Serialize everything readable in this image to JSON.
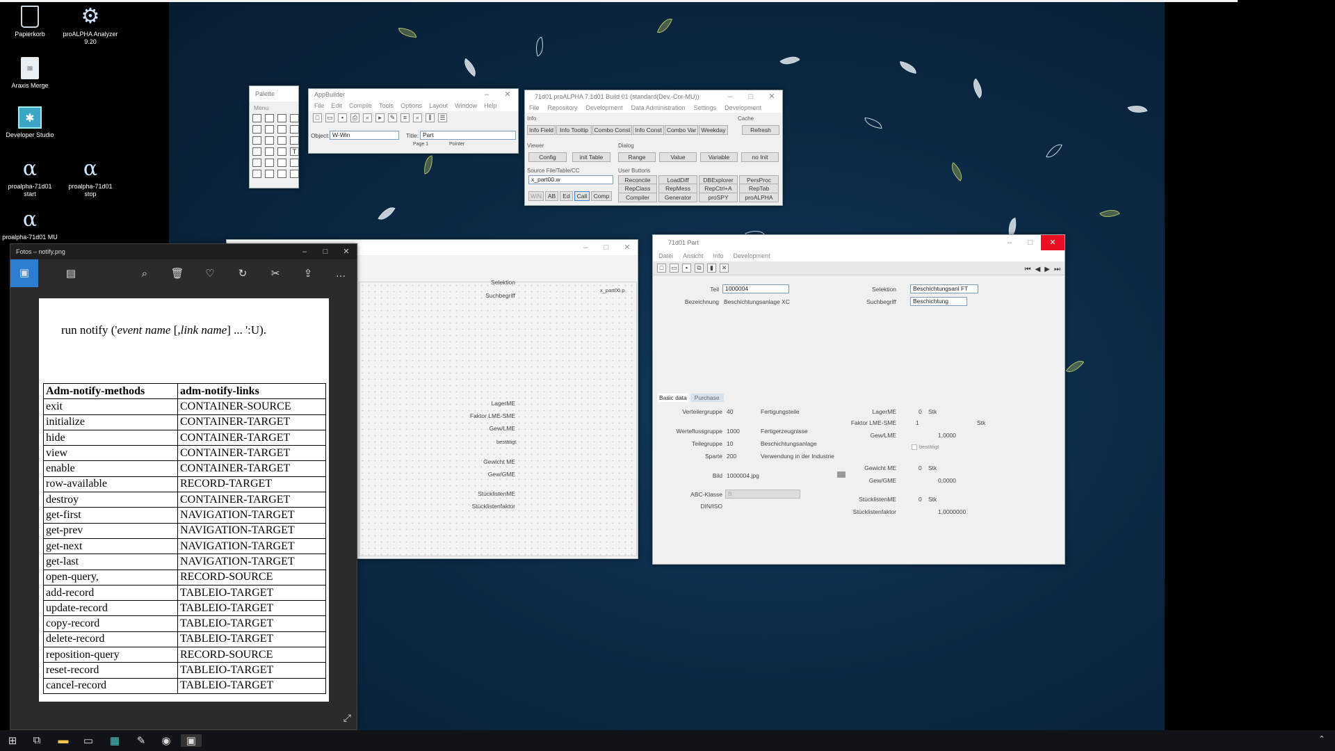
{
  "desktop": {
    "icons": [
      {
        "label": "Papierkorb",
        "sym": "🗑"
      },
      {
        "label": "proALPHA Analyzer 9.20",
        "sym": "⚙"
      },
      {
        "label": "Araxis Merge",
        "sym": "≡"
      },
      {
        "label": "Developer Studio",
        "sym": "✱"
      },
      {
        "label": "proalpha-71d01 start",
        "sym": "α"
      },
      {
        "label": "proalpha-71d01 stop",
        "sym": "α"
      },
      {
        "label": "proalpha-71d01 MU",
        "sym": "α"
      }
    ]
  },
  "palette": {
    "title": "Palette",
    "menu": "Menu"
  },
  "appbuilder": {
    "title": "AppBuilder",
    "menu": [
      "File",
      "Edit",
      "Compile",
      "Tools",
      "Options",
      "Layout",
      "Window",
      "Help"
    ],
    "object_label": "Object:",
    "object_value": "W-Win",
    "title_label": "Title:",
    "title_value": "Part",
    "page_label": "Page 1",
    "pointer_label": "Pointer"
  },
  "devtool": {
    "title": "71d01 proALPHA 7.1d01 Build 01 (standard(Dev.-Cor-MU))",
    "menu": [
      "File",
      "Repository",
      "Development",
      "Data Administration",
      "Settings",
      "Development"
    ],
    "info_label": "Info",
    "cache_label": "Cache",
    "info_buttons": [
      "Info Field",
      "Info Tooltip",
      "Combo Const",
      "Info Const",
      "Combo Var",
      "Weekday"
    ],
    "refresh": "Refresh",
    "viewer_label": "Viewer",
    "viewer_buttons": [
      "Config",
      "init Table"
    ],
    "dialog_label": "Dialog",
    "dialog_buttons": [
      "Range",
      "Value",
      "Variable",
      "no Init"
    ],
    "source_label": "Source File/Table/CC",
    "source_value": "x_part00.w",
    "source_buttons": [
      "WiN",
      "AB",
      "Ed",
      "Call",
      "Comp"
    ],
    "user_label": "User Buttons",
    "user_buttons": [
      [
        "Reconcile",
        "LoadDiff",
        "DBExplorer",
        "PersProc"
      ],
      [
        "RepClass",
        "RepMess",
        "RepCtrl+A",
        "RepTab"
      ],
      [
        "Compiler",
        "Generator",
        "proSPY",
        "proALPHA"
      ]
    ]
  },
  "midwin": {
    "labels": {
      "selektion": "Selektion",
      "suchbegriff": "Suchbegriff",
      "lagerme": "LagerME",
      "faktor": "Faktor LME-SME",
      "gew": "Gew/LME",
      "bestaetigt": "bestätigt",
      "gewicht": "Gewicht ME",
      "gewgme": "Gew/GME",
      "stueck": "StücklistenME",
      "stueckf": "Stücklistenfaktor"
    },
    "file": "x_part00.p"
  },
  "part": {
    "title": "71d01 Part",
    "menu": [
      "Datei",
      "Ansicht",
      "Info",
      "Development"
    ],
    "teil_label": "Teil",
    "teil_value": "1000004",
    "bez_label": "Bezeichnung",
    "bez_value": "Beschichtungsanlage XC",
    "sel_label": "Selektion",
    "sel_value": "Beschichtungsanl FT",
    "such_label": "Suchbegriff",
    "such_value": "Beschichtung",
    "tabs": [
      "Basic data",
      "Purchase"
    ],
    "vert_label": "Verteilergruppe",
    "vert_value": "40",
    "vert_text": "Fertigungsteile",
    "wert_label": "Wertefluss­gruppe",
    "wert_value": "1000",
    "wert_text": "Fertigerzeugnisse",
    "teilegr_label": "Teilegruppe",
    "teilegr_value": "10",
    "teilegr_text": "Beschichtungsanlage",
    "sparte_label": "Sparte",
    "sparte_value": "200",
    "sparte_text": "Verwendung in der Industrie",
    "bild_label": "Bild",
    "bild_value": "1000004.jpg",
    "abc_label": "ABC-Klasse",
    "abc_value": "B",
    "din_label": "DIN/ISO",
    "lager_label": "LagerME",
    "lager_value": "0",
    "lager_unit": "Stk",
    "faktor_label": "Faktor LME-SME",
    "faktor_value": "1",
    "faktor_unit": "Stk",
    "gew_label": "Gew/LME",
    "gew_value": "1,0000",
    "best_label": "bestätigt",
    "gewme_label": "Gewicht ME",
    "gewme_value": "0",
    "gewme_unit": "Stk",
    "gewgme_label": "Gew/GME",
    "gewgme_value": "0,0000",
    "stme_label": "StücklistenME",
    "stme_value": "0",
    "stme_unit": "Stk",
    "stf_label": "Stücklistenfaktor",
    "stf_value": "1,0000000"
  },
  "photos": {
    "title": "Fotos – notify.png",
    "code_prefix": "run notify ('",
    "code_em1": "event name",
    "code_mid": " [,",
    "code_em2": "link name",
    "code_suffix": "] ... ':U).",
    "table_headers": [
      "Adm-notify-methods",
      "adm-notify-links"
    ],
    "rows": [
      [
        "exit",
        "CONTAINER-SOURCE"
      ],
      [
        "initialize",
        "CONTAINER-TARGET"
      ],
      [
        "hide",
        "CONTAINER-TARGET"
      ],
      [
        "view",
        "CONTAINER-TARGET"
      ],
      [
        "enable",
        "CONTAINER-TARGET"
      ],
      [
        "row-available",
        "RECORD-TARGET"
      ],
      [
        "destroy",
        "CONTAINER-TARGET"
      ],
      [
        "get-first",
        "NAVIGATION-TARGET"
      ],
      [
        "get-prev",
        "NAVIGATION-TARGET"
      ],
      [
        "get-next",
        "NAVIGATION-TARGET"
      ],
      [
        "get-last",
        "NAVIGATION-TARGET"
      ],
      [
        "open-query,",
        "RECORD-SOURCE"
      ],
      [
        "add-record",
        "TABLEIO-TARGET"
      ],
      [
        "update-record",
        "TABLEIO-TARGET"
      ],
      [
        "copy-record",
        "TABLEIO-TARGET"
      ],
      [
        "delete-record",
        "TABLEIO-TARGET"
      ],
      [
        "reposition-query",
        "RECORD-SOURCE"
      ],
      [
        "reset-record",
        "TABLEIO-TARGET"
      ],
      [
        "cancel-record",
        "TABLEIO-TARGET"
      ]
    ]
  }
}
